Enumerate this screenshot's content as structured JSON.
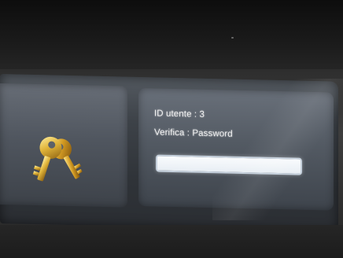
{
  "login_screen": {
    "id_line": "ID utente : 3",
    "verify_line": "Verifica : Password",
    "password_value": ""
  },
  "icons": {
    "keys": "keys-icon"
  },
  "colors": {
    "panel_gray": "#5a616a",
    "key_gold": "#d8a829",
    "input_border": "#c5d0dc"
  }
}
